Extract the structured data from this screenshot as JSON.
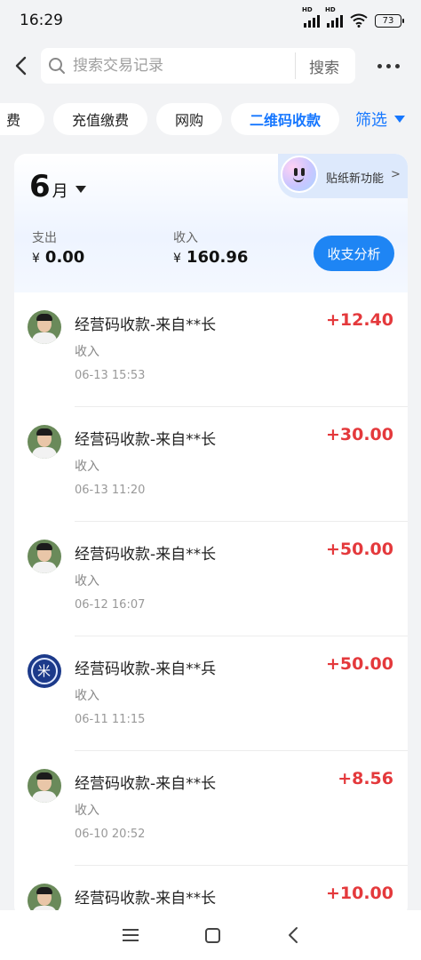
{
  "status_bar": {
    "time": "16:29",
    "battery": "73",
    "hd_label": "HD"
  },
  "search": {
    "placeholder": "搜索交易记录",
    "button_label": "搜索"
  },
  "chips": [
    {
      "label": "费"
    },
    {
      "label": "充值缴费"
    },
    {
      "label": "网购"
    },
    {
      "label": "二维码收款"
    }
  ],
  "filter_label": "筛选",
  "sticker": {
    "label": "贴纸新功能",
    "arrow": ">"
  },
  "summary": {
    "month_number": "6",
    "month_unit": "月",
    "expense_label": "支出",
    "expense_value": "0.00",
    "income_label": "收入",
    "income_value": "160.96",
    "currency": "¥",
    "analysis_button": "收支分析"
  },
  "transactions": [
    {
      "title": "经营码收款-来自**长",
      "type": "收入",
      "time": "06-13 15:53",
      "amount": "+12.40"
    },
    {
      "title": "经营码收款-来自**长",
      "type": "收入",
      "time": "06-13 11:20",
      "amount": "+30.00"
    },
    {
      "title": "经营码收款-来自**长",
      "type": "收入",
      "time": "06-12 16:07",
      "amount": "+50.00"
    },
    {
      "title": "经营码收款-来自**兵",
      "type": "收入",
      "time": "06-11 11:15",
      "amount": "+50.00",
      "avatar_glyph": "米"
    },
    {
      "title": "经营码收款-来自**长",
      "type": "收入",
      "time": "06-10 20:52",
      "amount": "+8.56"
    },
    {
      "title": "经营码收款-来自**长",
      "type": "收入",
      "time": "",
      "amount": "+10.00"
    }
  ],
  "colors": {
    "accent": "#1677ff",
    "income": "#e4393c",
    "button": "#1e85f4"
  },
  "icons": [
    "back-arrow-icon",
    "search-icon",
    "more-icon",
    "filter-caret-icon",
    "sticker-face-icon",
    "menu-icon",
    "home-icon",
    "back-nav-icon"
  ]
}
